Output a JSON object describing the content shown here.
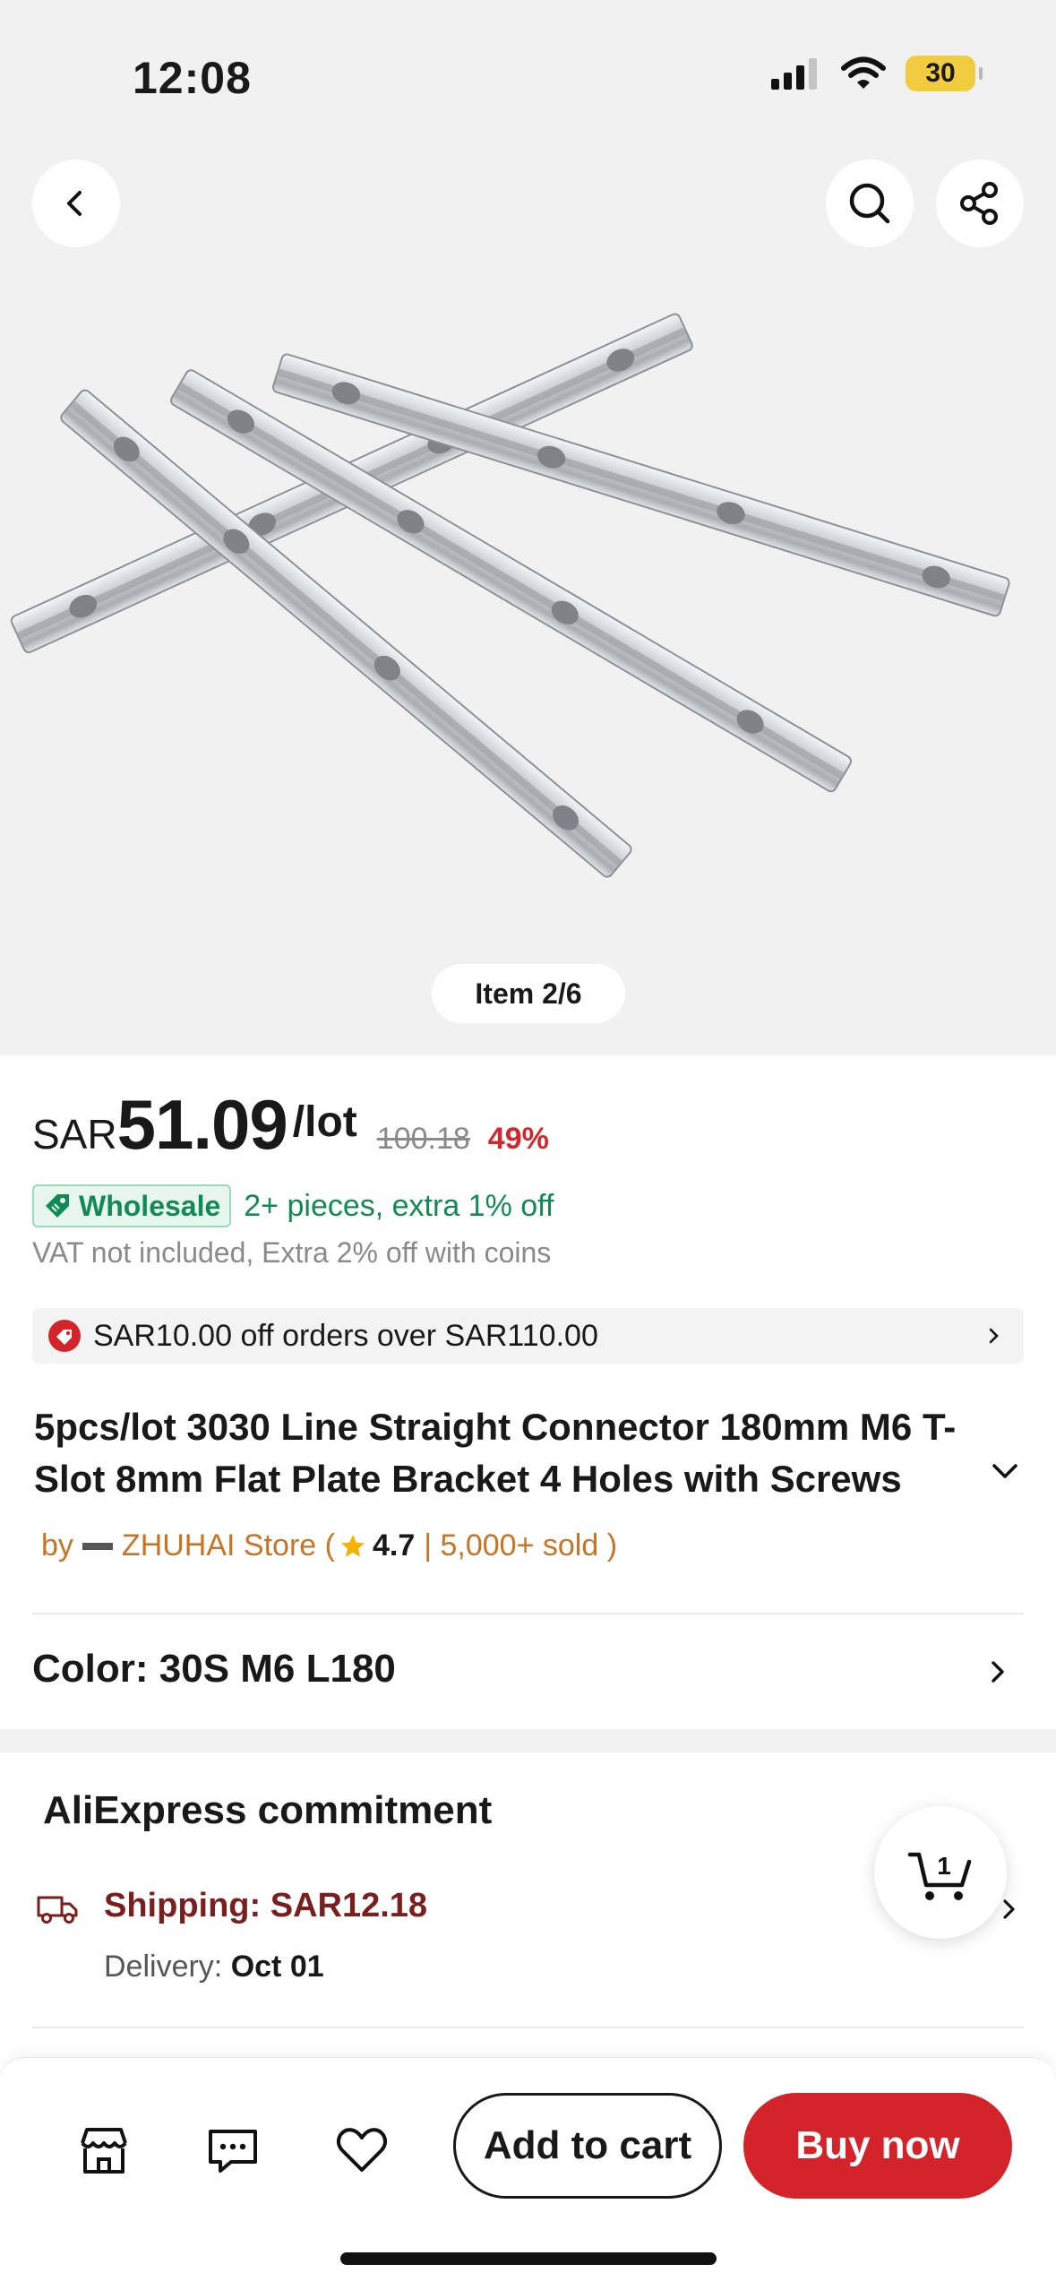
{
  "status_bar": {
    "time": "12:08",
    "battery": "30"
  },
  "gallery": {
    "counter": "Item 2/6"
  },
  "price": {
    "currency": "SAR",
    "amount": "51.09",
    "unit": "/lot",
    "original": "100.18",
    "discount": "49%"
  },
  "wholesale": {
    "badge": "Wholesale",
    "text": "2+ pieces, extra 1% off"
  },
  "vat_note": "VAT not included, Extra 2% off with coins",
  "coupon": {
    "text": "SAR10.00 off orders over SAR110.00"
  },
  "product": {
    "title": "5pcs/lot 3030 Line Straight Connector 180mm M6 T-Slot 8mm Flat Plate Bracket 4 Holes with Screws"
  },
  "store": {
    "by": "by",
    "name": "ZHUHAI Store (",
    "rating": "4.7",
    "sold": "| 5,000+ sold )"
  },
  "variant": {
    "label": "Color: 30S M6 L180"
  },
  "commitment": {
    "title": "AliExpress commitment",
    "shipping": "Shipping: SAR12.18",
    "delivery_label": "Delivery:",
    "delivery_date": "Oct 01"
  },
  "cart": {
    "count": "1"
  },
  "actions": {
    "add_to_cart": "Add to cart",
    "buy_now": "Buy now"
  },
  "colors": {
    "accent_red": "#d3232b",
    "wholesale_green": "#128a53",
    "store_orange": "#c77424",
    "shipping_red": "#7a1f1f"
  }
}
